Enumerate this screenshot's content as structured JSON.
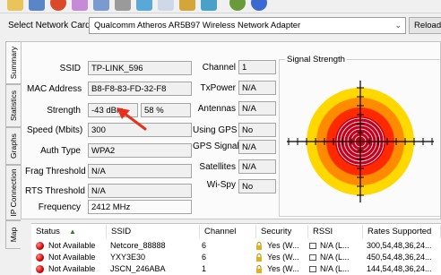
{
  "toolbar": {
    "icons": [
      "open-folder-icon",
      "save-icon",
      "start-icon",
      "eraser-icon",
      "chart-icon",
      "filter-icon",
      "check-icon",
      "document-icon",
      "export-icon",
      "web-icon",
      "help-icon"
    ]
  },
  "network_card": {
    "label": "Select Network Card",
    "selected": "Qualcomm Atheros AR5B97 Wireless Network Adapter",
    "reload_label": "Reload C"
  },
  "tabs": [
    "Summary",
    "Statistics",
    "Graphs",
    "IP Connection",
    "Map"
  ],
  "summary": {
    "ssid": {
      "label": "SSID",
      "value": "TP-LINK_596"
    },
    "mac": {
      "label": "MAC Address",
      "value": "B8-F8-83-FD-32-F8"
    },
    "strength": {
      "label": "Strength",
      "value": "-43 dBm",
      "percent": "58 %"
    },
    "speed": {
      "label": "Speed (Mbits)",
      "value": "300"
    },
    "auth": {
      "label": "Auth Type",
      "value": "WPA2"
    },
    "frag": {
      "label": "Frag Threshold",
      "value": "N/A"
    },
    "rts": {
      "label": "RTS Threshold",
      "value": "N/A"
    },
    "frequency": {
      "label": "Frequency",
      "value": "2412 MHz"
    },
    "channel": {
      "label": "Channel",
      "value": "1"
    },
    "txpower": {
      "label": "TxPower",
      "value": "N/A"
    },
    "antennas": {
      "label": "Antennas",
      "value": "N/A"
    },
    "using_gps": {
      "label": "Using GPS",
      "value": "No"
    },
    "gps_signal": {
      "label": "GPS Signal",
      "value": "N/A"
    },
    "satellites": {
      "label": "Satellites",
      "value": "N/A"
    },
    "wispy": {
      "label": "Wi-Spy",
      "value": "No"
    }
  },
  "signal": {
    "title": "Signal Strength",
    "ring_colors": [
      "#ffd800",
      "#ff8c00",
      "#ff2a00",
      "#c8001e"
    ]
  },
  "table": {
    "headers": [
      "Status",
      "SSID",
      "Channel",
      "Security",
      "RSSI",
      "Rates Supported"
    ],
    "rows": [
      {
        "status": "Not Available",
        "ssid": "Netcore_88888",
        "channel": "6",
        "security": "Yes (W...",
        "rssi": "N/A (L...",
        "rates": "300,54,48,36,24..."
      },
      {
        "status": "Not Available",
        "ssid": "YXY3E30",
        "channel": "6",
        "security": "Yes (W...",
        "rssi": "N/A (L...",
        "rates": "450,54,48,36,24..."
      },
      {
        "status": "Not Available",
        "ssid": "JSCN_246ABA",
        "channel": "1",
        "security": "Yes (W...",
        "rssi": "N/A (L...",
        "rates": "144,54,48,36,24..."
      }
    ]
  }
}
